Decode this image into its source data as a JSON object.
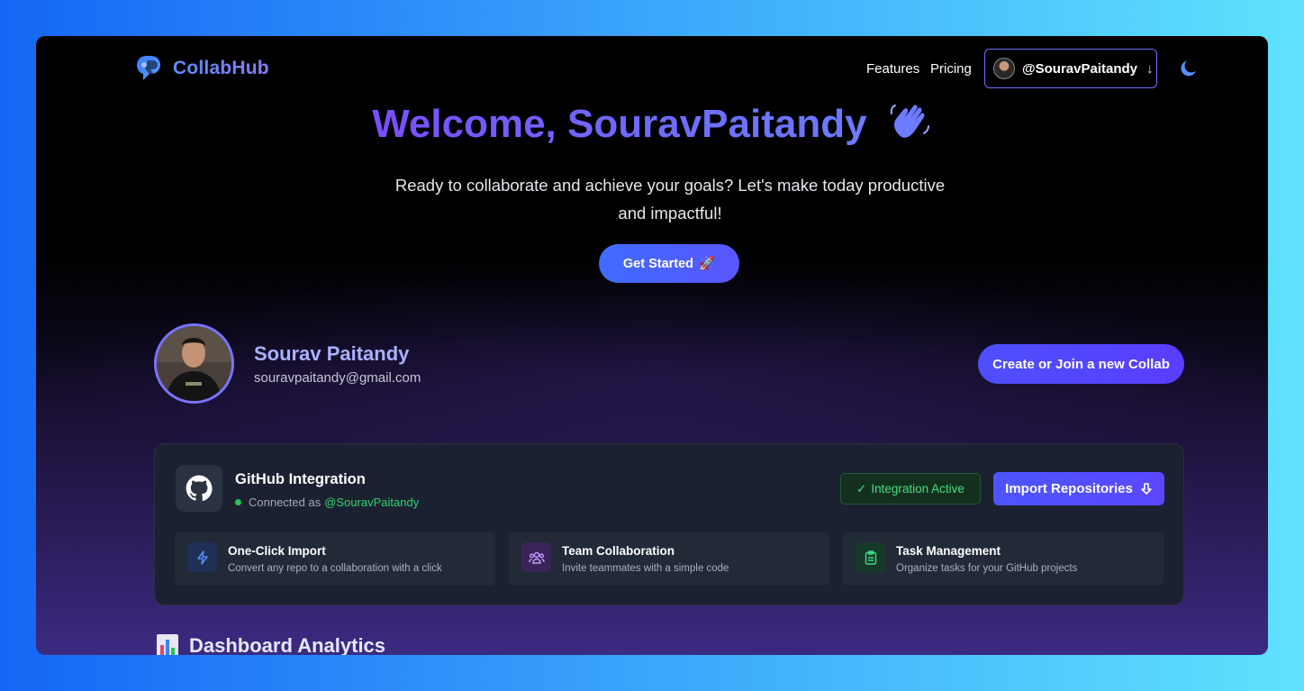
{
  "nav": {
    "brand": "CollabHub",
    "features_label": "Features",
    "pricing_label": "Pricing",
    "user_handle": "@SouravPaitandy",
    "user_menu_arrow": "↓"
  },
  "hero": {
    "title": "Welcome, SouravPaitandy",
    "subtitle": "Ready to collaborate and achieve your goals? Let's make today productive and impactful!",
    "cta_label": "Get Started",
    "cta_emoji": "🚀"
  },
  "profile": {
    "name": "Sourav Paitandy",
    "email": "souravpaitandy@gmail.com",
    "collab_button": "Create or Join a new Collab"
  },
  "github": {
    "title": "GitHub Integration",
    "connected_prefix": "Connected as",
    "connected_user": "@SouravPaitandy",
    "status_badge": "Integration Active",
    "status_check": "✓",
    "import_button": "Import Repositories",
    "features": [
      {
        "title": "One-Click Import",
        "desc": "Convert any repo to a collaboration with a click",
        "icon": "bolt-icon",
        "color": "#5b8dff"
      },
      {
        "title": "Team Collaboration",
        "desc": "Invite teammates with a simple code",
        "icon": "users-icon",
        "color": "#b98cff"
      },
      {
        "title": "Task Management",
        "desc": "Organize tasks for your GitHub projects",
        "icon": "clipboard-icon",
        "color": "#3ddc84"
      }
    ]
  },
  "analytics": {
    "title": "Dashboard Analytics"
  },
  "colors": {
    "accent": "#5a55ff",
    "brand": "#6d8cff",
    "success": "#4ade80"
  }
}
